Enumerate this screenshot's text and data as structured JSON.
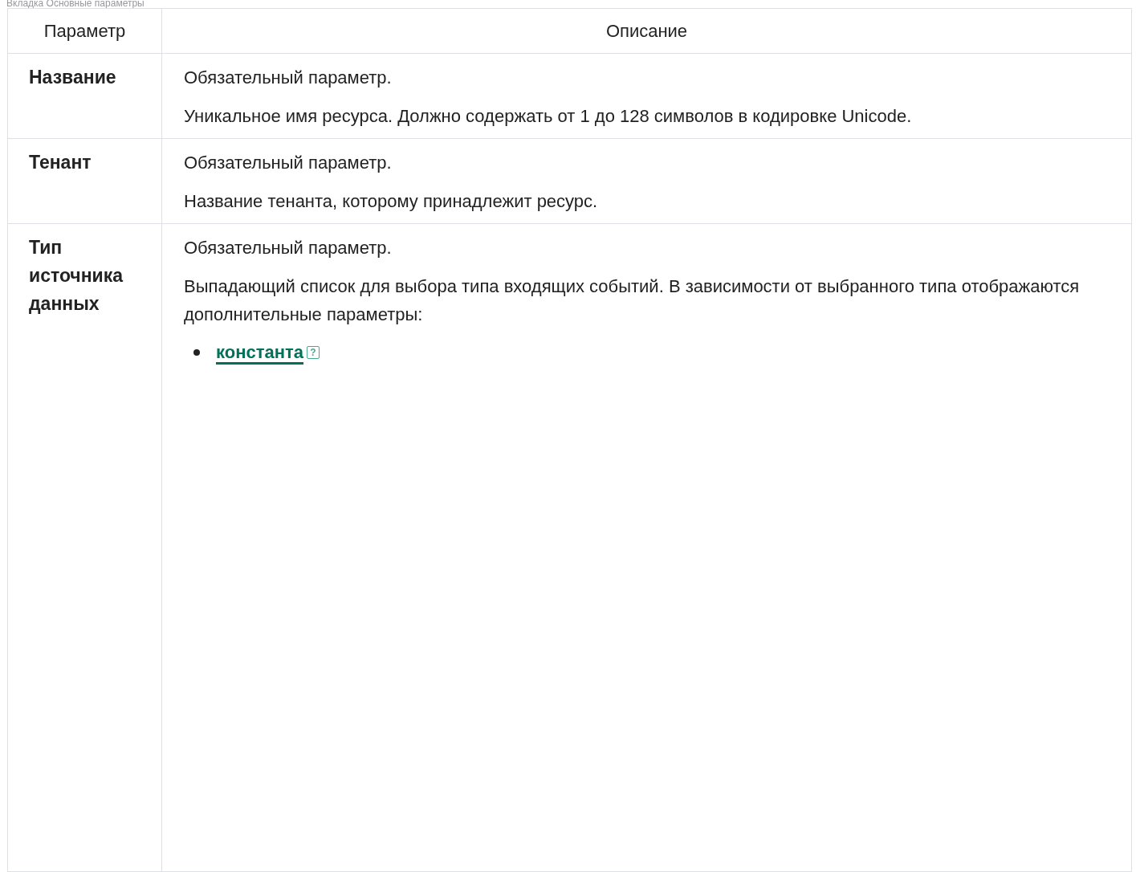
{
  "caption": "Вкладка Основные параметры",
  "table": {
    "columns": [
      "Параметр",
      "Описание"
    ],
    "rows": [
      {
        "parameter": "Название",
        "paragraphs": [
          "Обязательный параметр.",
          "Уникальное имя ресурса. Должно содержать от 1 до 128 символов в кодировке Unicode."
        ]
      },
      {
        "parameter": "Тенант",
        "paragraphs": [
          "Обязательный параметр.",
          "Название тенанта, которому принадлежит ресурс."
        ]
      },
      {
        "parameter": "Тип источника данных",
        "paragraphs": [
          "Обязательный параметр.",
          "Выпадающий список для выбора типа входящих событий. В зависимости от выбранного типа отображаются дополнительные параметры:"
        ],
        "list": [
          {
            "link": "константа",
            "help": "?"
          }
        ]
      }
    ]
  }
}
